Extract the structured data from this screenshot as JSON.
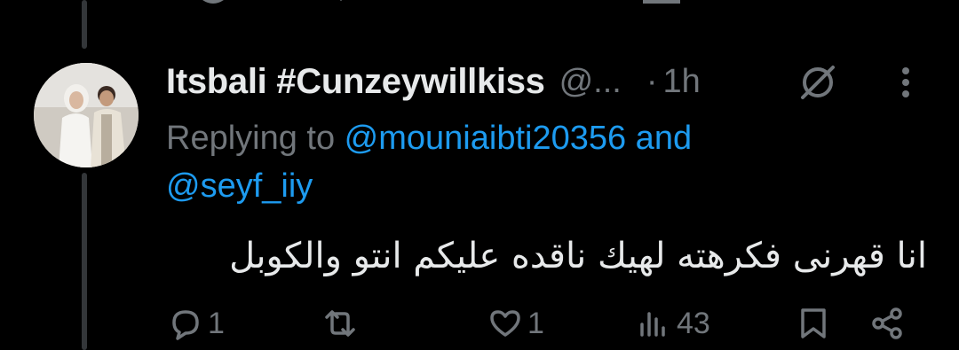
{
  "tweet": {
    "author_name": "Itsbali #Cunzeywillkiss",
    "author_handle": "@...",
    "dot": "·",
    "time": "1h",
    "replying_prefix": "Replying to ",
    "reply_to_1": "@mouniaibti20356",
    "reply_joiner": " and",
    "reply_to_2": "@seyf_iiy",
    "text": "انا قهرنى فكرهته لهيك ناقده عليكم انتو والكوبل"
  },
  "actions": {
    "reply_count": "1",
    "retweet_count": "",
    "like_count": "1",
    "views_count": "43"
  },
  "icons": {
    "reply": "comment-icon",
    "retweet": "retweet-icon",
    "like": "heart-icon",
    "views": "views-chart-icon",
    "bookmark": "bookmark-icon",
    "share": "share-icon",
    "muted": "muted-circle-icon",
    "more": "more-vertical-icon"
  },
  "colors": {
    "background": "#000000",
    "text": "#e7e9ea",
    "secondary": "#71767b",
    "link": "#1d9bf0"
  }
}
